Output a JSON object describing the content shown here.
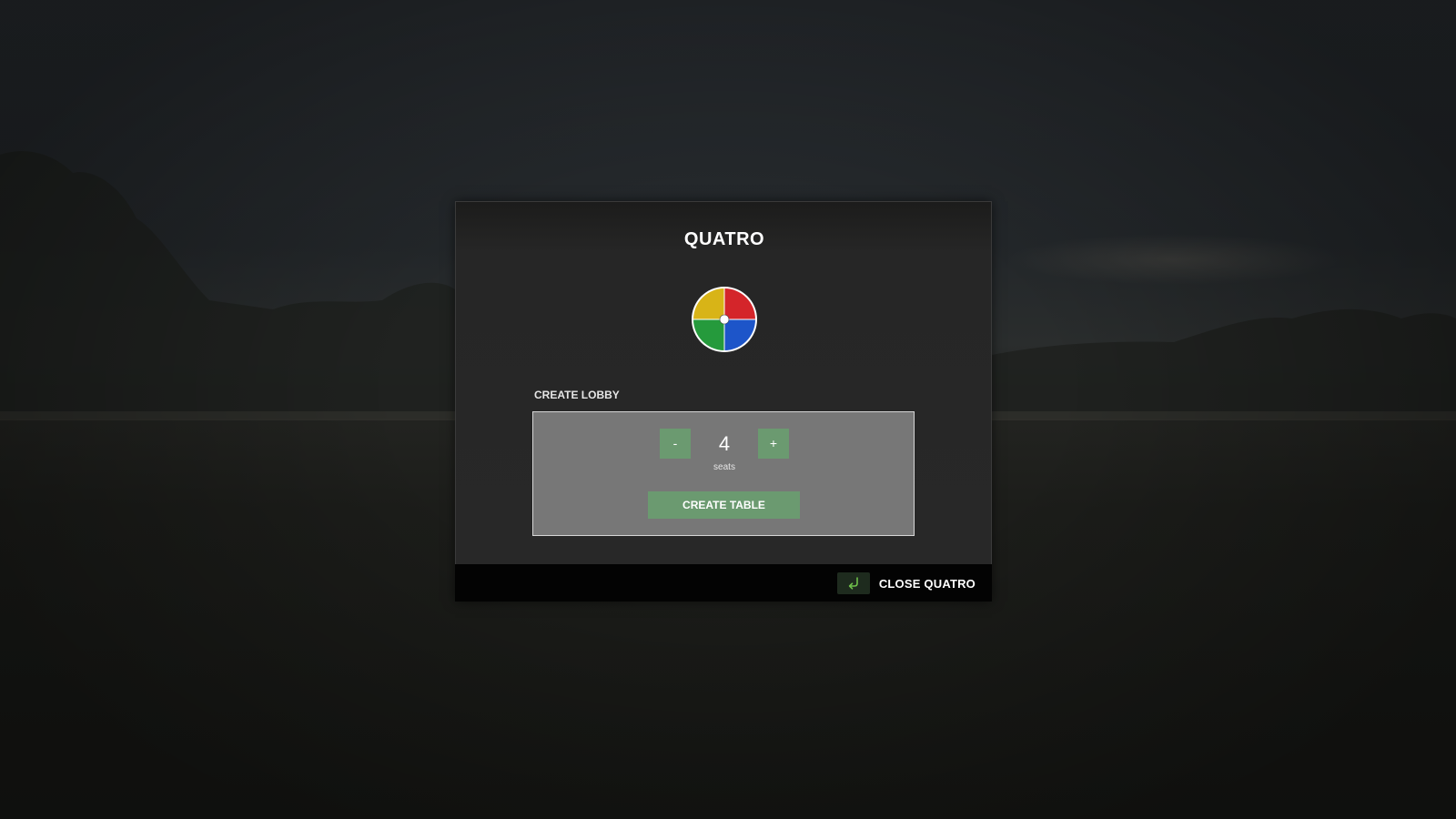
{
  "dialog": {
    "title": "QUATRO",
    "logo_colors": {
      "top_left": "#d8b417",
      "top_right": "#d4252a",
      "bottom_left": "#259a3c",
      "bottom_right": "#1d55c9"
    }
  },
  "lobby": {
    "section_label": "CREATE LOBBY",
    "decrement_label": "-",
    "increment_label": "+",
    "seat_count": "4",
    "seat_unit": "seats",
    "create_label": "CREATE TABLE"
  },
  "footer": {
    "close_key_icon": "return-key-icon",
    "close_label": "CLOSE QUATRO"
  },
  "colors": {
    "accent_green": "#6b9a70",
    "panel_gray": "#777777"
  }
}
